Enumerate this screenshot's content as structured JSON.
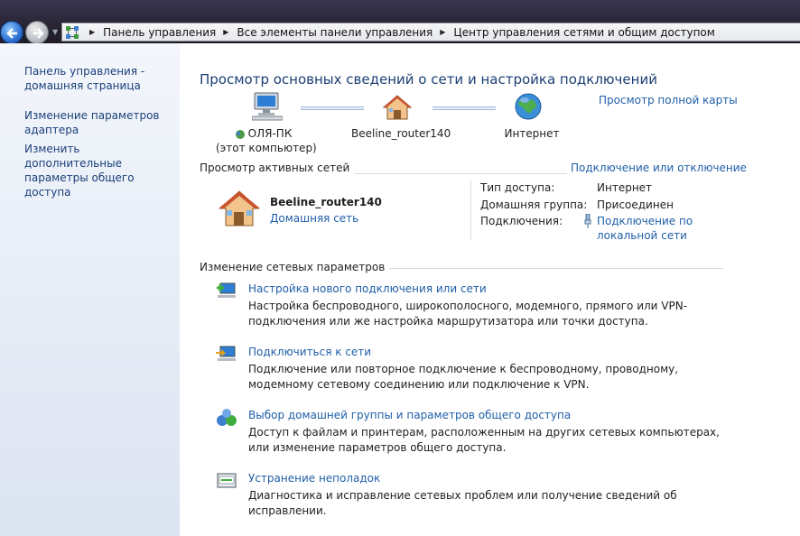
{
  "breadcrumb": [
    "Панель управления",
    "Все элементы панели управления",
    "Центр управления сетями и общим доступом"
  ],
  "sidebar": {
    "items": [
      {
        "label": "Панель управления - домашняя страница"
      },
      {
        "label": "Изменение параметров адаптера"
      },
      {
        "label": "Изменить дополнительные параметры общего доступа"
      }
    ]
  },
  "main": {
    "title": "Просмотр основных сведений о сети и настройка подключений",
    "full_map_link": "Просмотр полной карты",
    "network_map": {
      "computer_name": "ОЛЯ-ПК",
      "computer_note": "(этот компьютер)",
      "router": "Beeline_router140",
      "internet": "Интернет"
    },
    "active_networks": {
      "header": "Просмотр активных сетей",
      "connect_link": "Подключение или отключение",
      "network_name": "Beeline_router140",
      "network_type": "Домашняя сеть",
      "access_type_label": "Тип доступа:",
      "access_type_value": "Интернет",
      "homegroup_label": "Домашняя группа:",
      "homegroup_value": "Присоединен",
      "connections_label": "Подключения:",
      "connections_value_1": "Подключение по",
      "connections_value_2": "локальной сети"
    },
    "change_settings": {
      "header": "Изменение сетевых параметров",
      "tasks": [
        {
          "title": "Настройка нового подключения или сети",
          "desc": "Настройка беспроводного, широкополосного, модемного, прямого или VPN-подключения или же настройка маршрутизатора или точки доступа.",
          "icon": "new-connection-icon"
        },
        {
          "title": "Подключиться к сети",
          "desc": "Подключение или повторное подключение к беспроводному, проводному, модемному сетевому соединению или подключение к VPN.",
          "icon": "connect-network-icon"
        },
        {
          "title": "Выбор домашней группы и параметров общего доступа",
          "desc": "Доступ к файлам и принтерам, расположенным на других сетевых компьютерах, или изменение параметров общего доступа.",
          "icon": "homegroup-icon"
        },
        {
          "title": "Устранение неполадок",
          "desc": "Диагностика и исправление сетевых проблем или получение сведений об исправлении.",
          "icon": "troubleshoot-icon"
        }
      ]
    }
  },
  "colors": {
    "link": "#1f5fa8",
    "title": "#1b3f75",
    "sidebar_bg": "#e6ecf6"
  }
}
